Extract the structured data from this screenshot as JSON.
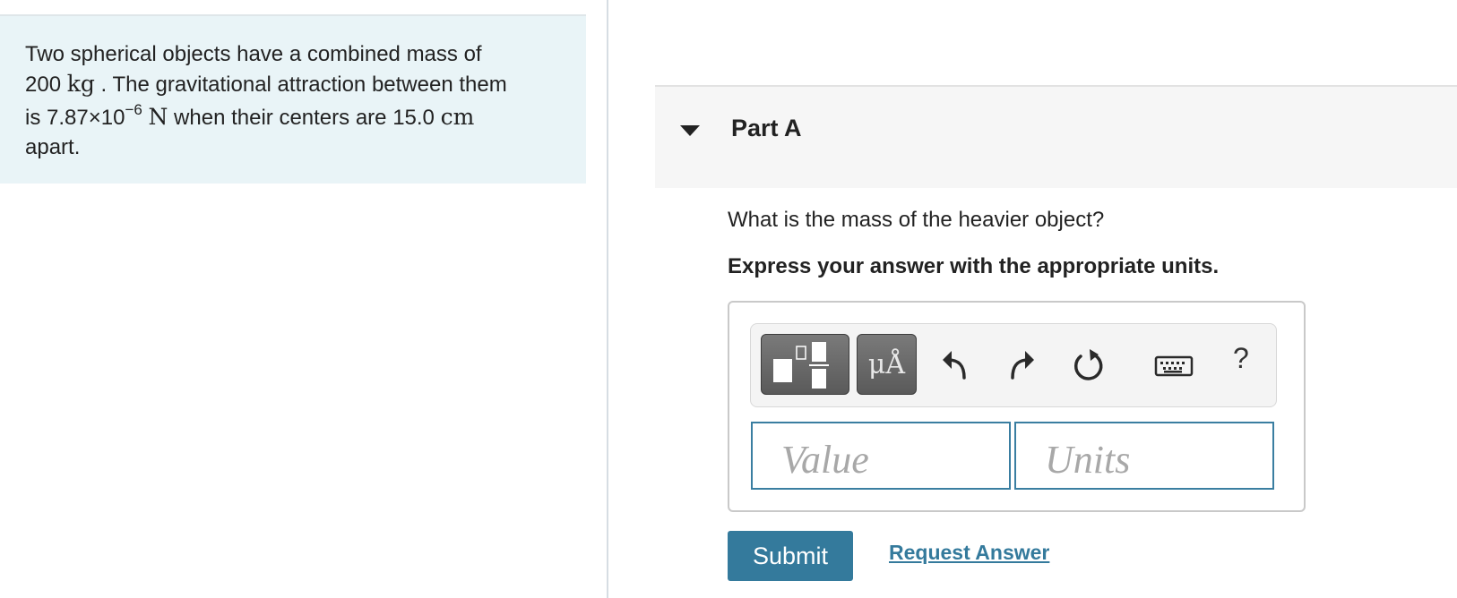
{
  "problem": {
    "line1": "Two spherical objects have a combined mass of",
    "mass_value": "200",
    "mass_unit": "kg",
    "line2_rest": ". The gravitational attraction between them",
    "is_text": "is",
    "force_mantissa": "7.87×10",
    "force_exponent": "−6",
    "force_unit": "N",
    "when_text": "when their centers are",
    "distance_value": "15.0",
    "distance_unit": "cm",
    "line4": "apart."
  },
  "part": {
    "title": "Part A",
    "question": "What is the mass of the heavier object?",
    "instruction": "Express your answer with the appropriate units."
  },
  "toolbar": {
    "templates_icon": "templates-icon",
    "units_label": "μÅ",
    "undo_icon": "undo-icon",
    "redo_icon": "redo-icon",
    "reset_icon": "reset-icon",
    "keyboard_icon": "keyboard-icon",
    "help_label": "?"
  },
  "inputs": {
    "value_placeholder": "Value",
    "units_placeholder": "Units"
  },
  "actions": {
    "submit_label": "Submit",
    "request_label": "Request Answer"
  },
  "colors": {
    "accent": "#347a9c",
    "problem_bg": "#e9f4f7",
    "header_bg": "#f6f6f6"
  }
}
